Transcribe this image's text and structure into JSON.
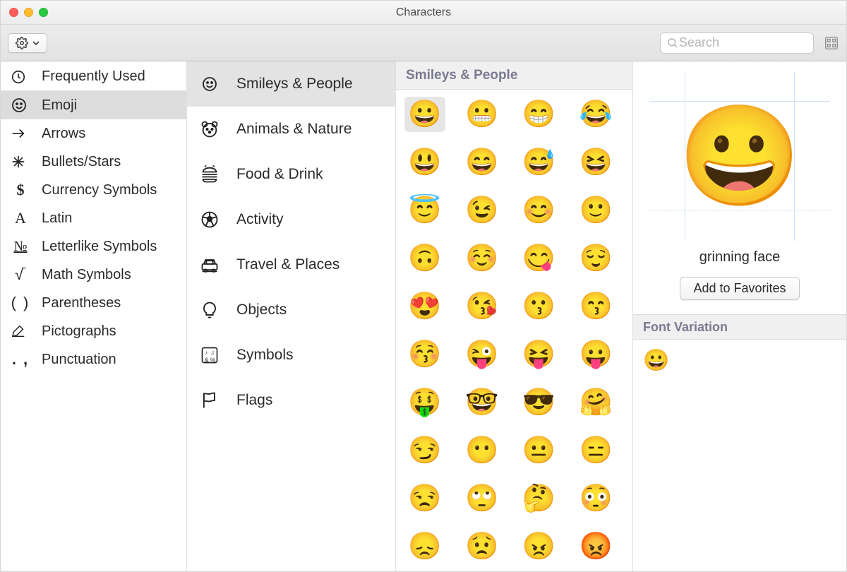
{
  "window": {
    "title": "Characters"
  },
  "toolbar": {
    "search_placeholder": "Search"
  },
  "sidebar": {
    "items": [
      {
        "label": "Frequently Used",
        "icon": "clock"
      },
      {
        "label": "Emoji",
        "icon": "smiley",
        "selected": true
      },
      {
        "label": "Arrows",
        "icon": "arrow"
      },
      {
        "label": "Bullets/Stars",
        "icon": "burst"
      },
      {
        "label": "Currency Symbols",
        "icon": "dollar"
      },
      {
        "label": "Latin",
        "icon": "letterA"
      },
      {
        "label": "Letterlike Symbols",
        "icon": "numero"
      },
      {
        "label": "Math Symbols",
        "icon": "sqrt"
      },
      {
        "label": "Parentheses",
        "icon": "parens"
      },
      {
        "label": "Pictographs",
        "icon": "quill"
      },
      {
        "label": "Punctuation",
        "icon": "punct"
      }
    ]
  },
  "subcategories": {
    "items": [
      {
        "label": "Smileys & People",
        "icon": "smiley",
        "selected": true
      },
      {
        "label": "Animals & Nature",
        "icon": "bear"
      },
      {
        "label": "Food & Drink",
        "icon": "burger"
      },
      {
        "label": "Activity",
        "icon": "soccer"
      },
      {
        "label": "Travel & Places",
        "icon": "car"
      },
      {
        "label": "Objects",
        "icon": "bulb"
      },
      {
        "label": "Symbols",
        "icon": "symbols"
      },
      {
        "label": "Flags",
        "icon": "flag"
      }
    ]
  },
  "grid": {
    "header": "Smileys & People",
    "rows": [
      [
        "😀",
        "😬",
        "😁",
        "😂"
      ],
      [
        "😃",
        "😄",
        "😅",
        "😆"
      ],
      [
        "😇",
        "😉",
        "😊",
        "🙂"
      ],
      [
        "🙃",
        "☺️",
        "😋",
        "😌"
      ],
      [
        "😍",
        "😘",
        "😗",
        "😙"
      ],
      [
        "😚",
        "😜",
        "😝",
        "😛"
      ],
      [
        "🤑",
        "🤓",
        "😎",
        "🤗"
      ],
      [
        "😏",
        "😶",
        "😐",
        "😑"
      ],
      [
        "😒",
        "🙄",
        "🤔",
        "😳"
      ],
      [
        "😞",
        "😟",
        "😠",
        "😡"
      ]
    ],
    "selected_row": 0,
    "selected_col": 0
  },
  "detail": {
    "preview_emoji": "😀",
    "emoji_name": "grinning face",
    "favorites_label": "Add to Favorites",
    "variation_header": "Font Variation",
    "variations": [
      "😀"
    ]
  }
}
